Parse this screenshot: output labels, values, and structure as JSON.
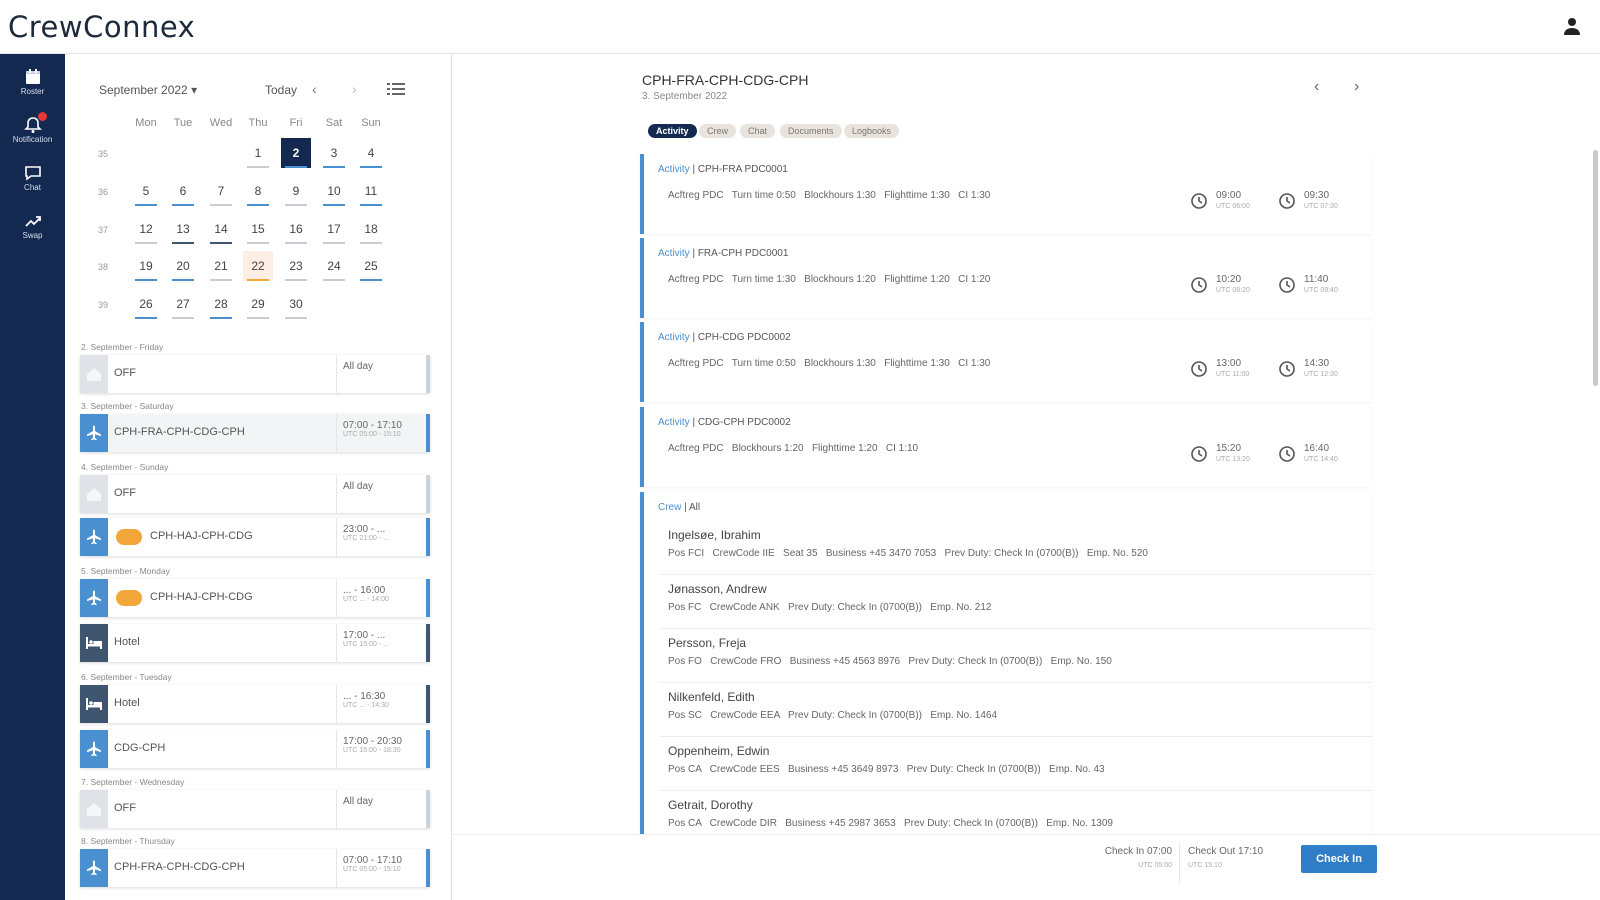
{
  "app": {
    "title": "CrewConnex"
  },
  "colors": {
    "navy": "#14294f",
    "flight": "#4a8fd0",
    "hotel": "#3f5570",
    "off": "#cdd3db",
    "accent": "#2f7ec7",
    "badge": "#f3a73b"
  },
  "nav": {
    "items": [
      {
        "label": "Roster",
        "icon": "calendar-icon"
      },
      {
        "label": "Notification",
        "icon": "bell-icon"
      },
      {
        "label": "Chat",
        "icon": "chat-icon"
      },
      {
        "label": "Swap",
        "icon": "swap-icon"
      }
    ]
  },
  "calendar": {
    "month_label": "September 2022",
    "today_label": "Today",
    "weekdays": [
      "Mon",
      "Tue",
      "Wed",
      "Thu",
      "Fri",
      "Sat",
      "Sun"
    ],
    "week_numbers": [
      "35",
      "36",
      "37",
      "38",
      "39"
    ],
    "selected_day": "2",
    "highlighted_day": "22",
    "days": [
      [
        "",
        "",
        "",
        "1",
        "2",
        "3",
        "4"
      ],
      [
        "5",
        "6",
        "7",
        "8",
        "9",
        "10",
        "11"
      ],
      [
        "12",
        "13",
        "14",
        "15",
        "16",
        "17",
        "18"
      ],
      [
        "19",
        "20",
        "21",
        "22",
        "23",
        "24",
        "25"
      ],
      [
        "26",
        "27",
        "28",
        "29",
        "30",
        "",
        ""
      ]
    ]
  },
  "events": {
    "groups": [
      {
        "label": "2. September - Friday"
      },
      {
        "label": "3. September - Saturday"
      },
      {
        "label": "4. September - Sunday"
      },
      {
        "label": "5. September - Monday"
      },
      {
        "label": "6. September - Tuesday"
      },
      {
        "label": "7. September - Wednesday"
      },
      {
        "label": "8. September - Thursday"
      }
    ],
    "items": [
      {
        "title": "OFF",
        "time": "All day",
        "utc": ""
      },
      {
        "title": "CPH-FRA-CPH-CDG-CPH",
        "time": "07:00 - 17:10",
        "utc": "UTC 05:00 - 15:10"
      },
      {
        "title": "OFF",
        "time": "All day",
        "utc": ""
      },
      {
        "title": "CPH-HAJ-CPH-CDG",
        "time": "23:00 - ...",
        "utc": "UTC 21:00 - ..."
      },
      {
        "title": "CPH-HAJ-CPH-CDG",
        "time": "... - 16:00",
        "utc": "UTC ... - 14:00"
      },
      {
        "title": "Hotel",
        "time": "17:00 - ...",
        "utc": "UTC 15:00 - ..."
      },
      {
        "title": "Hotel",
        "time": "... - 16:30",
        "utc": "UTC ... - 14:30"
      },
      {
        "title": "CDG-CPH",
        "time": "17:00 - 20:30",
        "utc": "UTC 15:00 - 18:30"
      },
      {
        "title": "OFF",
        "time": "All day",
        "utc": ""
      },
      {
        "title": "CPH-FRA-CPH-CDG-CPH",
        "time": "07:00 - 17:10",
        "utc": "UTC 05:00 - 15:10"
      }
    ]
  },
  "detail": {
    "title": "CPH-FRA-CPH-CDG-CPH",
    "subtitle": "3. September 2022",
    "tabs": [
      "Activity",
      "Crew",
      "Chat",
      "Documents",
      "Logbooks"
    ],
    "activities": [
      {
        "label": "Activity",
        "code": "CPH-FRA PDC0001",
        "details": "Acftreg PDC   Turn time 0:50   Blockhours 1:30   Flighttime 1:30   CI 1:30",
        "dep": "09:00",
        "dep_utc": "UTC 06:00",
        "arr": "09:30",
        "arr_utc": "UTC 07:30"
      },
      {
        "label": "Activity",
        "code": "FRA-CPH PDC0001",
        "details": "Acftreg PDC   Turn time 1:30   Blockhours 1:20   Flighttime 1:20   CI 1:20",
        "dep": "10:20",
        "dep_utc": "UTC 08:20",
        "arr": "11:40",
        "arr_utc": "UTC 09:40"
      },
      {
        "label": "Activity",
        "code": "CPH-CDG PDC0002",
        "details": "Acftreg PDC   Turn time 0:50   Blockhours 1:30   Flighttime 1:30   CI 1:30",
        "dep": "13:00",
        "dep_utc": "UTC 11:00",
        "arr": "14:30",
        "arr_utc": "UTC 12:30"
      },
      {
        "label": "Activity",
        "code": "CDG-CPH PDC0002",
        "details": "Acftreg PDC   Blockhours 1:20   Flighttime 1:20   CI 1:10",
        "dep": "15:20",
        "dep_utc": "UTC 13:20",
        "arr": "16:40",
        "arr_utc": "UTC 14:40"
      }
    ],
    "crew_label": "Crew",
    "crew_filter": "All",
    "crew": [
      {
        "name": "Ingelsøe, Ibrahim",
        "details": "Pos FCI   CrewCode IIE   Seat 35   Business +45 3470 7053   Prev Duty: Check In (0700(B))   Emp. No. 520"
      },
      {
        "name": "Jønasson, Andrew",
        "details": "Pos FC   CrewCode ANK   Prev Duty: Check In (0700(B))   Emp. No. 212"
      },
      {
        "name": "Persson, Freja",
        "details": "Pos FO   CrewCode FRO   Business +45 4563 8976   Prev Duty: Check In (0700(B))   Emp. No. 150"
      },
      {
        "name": "Nilkenfeld, Edith",
        "details": "Pos SC   CrewCode EEA   Prev Duty: Check In (0700(B))   Emp. No. 1464"
      },
      {
        "name": "Oppenheim, Edwin",
        "details": "Pos CA   CrewCode EES   Business +45 3649 8973   Prev Duty: Check In (0700(B))   Emp. No. 43"
      },
      {
        "name": "Getrait, Dorothy",
        "details": "Pos CA   CrewCode DIR   Business +45 2987 3653   Prev Duty: Check In (0700(B))   Emp. No. 1309"
      }
    ],
    "footer": {
      "check_in": "Check In 07:00",
      "check_in_utc": "UTC 05:00",
      "check_out": "Check Out 17:10",
      "check_out_utc": "UTC 15:10",
      "button": "Check In"
    }
  }
}
